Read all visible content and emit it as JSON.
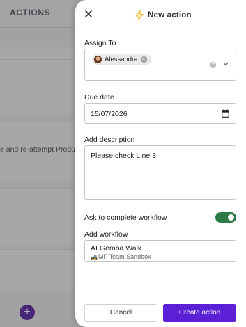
{
  "background": {
    "header_title": "ACTIONS",
    "row_snippet": "e and re-attempt Produc",
    "fab_label": "+"
  },
  "drawer": {
    "title": "New action",
    "assign_to": {
      "label": "Assign To",
      "chips": [
        {
          "name": "Alessandra"
        }
      ]
    },
    "due_date": {
      "label": "Due date",
      "value": "15/07/2026"
    },
    "description": {
      "label": "Add description",
      "value": "Please check Line 3"
    },
    "ask_complete": {
      "label": "Ask to complete workflow",
      "enabled": true
    },
    "workflow": {
      "label": "Add workflow",
      "name": "AI Gemba Walk",
      "sandbox_emoji": "🚜",
      "sandbox": "MP Team Sandbox"
    },
    "buttons": {
      "cancel": "Cancel",
      "create": "Create action"
    }
  },
  "colors": {
    "accent": "#5b1fd6",
    "toggle_on": "#2c7a46",
    "title_bolt": "#f2c233"
  }
}
